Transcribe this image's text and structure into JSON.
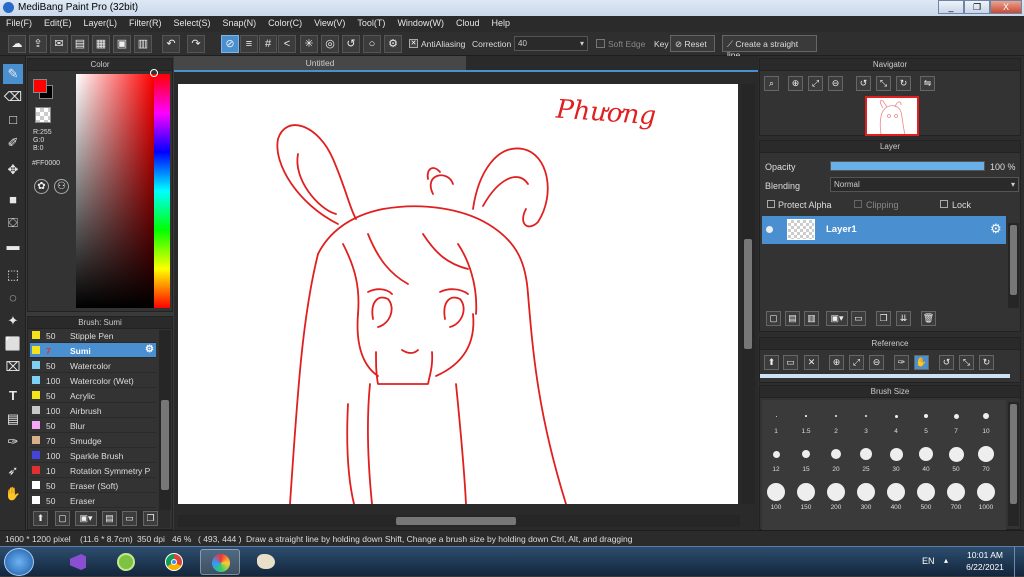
{
  "window": {
    "title": "MediBang Paint Pro (32bit)",
    "min": "_",
    "max": "❐",
    "close": "X"
  },
  "menu": [
    "File(F)",
    "Edit(E)",
    "Layer(L)",
    "Filter(R)",
    "Select(S)",
    "Snap(N)",
    "Color(C)",
    "View(V)",
    "Tool(T)",
    "Window(W)",
    "Cloud",
    "Help"
  ],
  "toolbar": {
    "antialiasing": "AntiAliasing",
    "correction_label": "Correction",
    "correction_value": "40",
    "soft_edge": "Soft Edge",
    "key": "Key",
    "reset": "Reset",
    "straight_line": "Create a straight line"
  },
  "color_panel": {
    "title": "Color",
    "r": "R:255",
    "g": "G:0",
    "b": "B:0",
    "hex": "#FF0000",
    "fg": "#ff0000",
    "bg": "#000000"
  },
  "brush_panel": {
    "title": "Brush: Sumi",
    "items": [
      {
        "size": "50",
        "name": "Stipple Pen",
        "color": "#f2e31b"
      },
      {
        "size": "7",
        "name": "Sumi",
        "color": "#f2e31b",
        "selected": true
      },
      {
        "size": "50",
        "name": "Watercolor",
        "color": "#7fd0f5"
      },
      {
        "size": "100",
        "name": "Watercolor (Wet)",
        "color": "#7fd0f5"
      },
      {
        "size": "50",
        "name": "Acrylic",
        "color": "#f2e31b"
      },
      {
        "size": "100",
        "name": "Airbrush",
        "color": "#c8c8c8"
      },
      {
        "size": "50",
        "name": "Blur",
        "color": "#f5a6f5"
      },
      {
        "size": "70",
        "name": "Smudge",
        "color": "#d8b08a"
      },
      {
        "size": "100",
        "name": "Sparkle Brush",
        "color": "#4444dd"
      },
      {
        "size": "10",
        "name": "Rotation Symmetry P",
        "color": "#e03030"
      },
      {
        "size": "50",
        "name": "Eraser (Soft)",
        "color": "#ffffff"
      },
      {
        "size": "50",
        "name": "Eraser",
        "color": "#ffffff"
      }
    ]
  },
  "document": {
    "tab": "Untitled",
    "signature": "Phương"
  },
  "navigator": {
    "title": "Navigator"
  },
  "layer_panel": {
    "title": "Layer",
    "opacity_label": "Opacity",
    "opacity_value": "100 %",
    "opacity": 1.0,
    "blending_label": "Blending",
    "blending_value": "Normal",
    "protect_alpha": "Protect Alpha",
    "clipping": "Clipping",
    "lock": "Lock",
    "layer_name": "Layer1"
  },
  "reference": {
    "title": "Reference"
  },
  "brush_size": {
    "title": "Brush Size",
    "sizes": [
      "1",
      "1.5",
      "2",
      "3",
      "4",
      "5",
      "7",
      "10",
      "12",
      "15",
      "20",
      "25",
      "30",
      "40",
      "50",
      "70",
      "100",
      "150",
      "200",
      "300",
      "400",
      "500",
      "700",
      "1000"
    ]
  },
  "status": {
    "dims": "1600 * 1200 pixel",
    "cm": "(11.6 * 8.7cm)",
    "dpi": "350 dpi",
    "zoom": "46 %",
    "coords": "( 493, 444 )",
    "hint": "Draw a straight line by holding down Shift, Change a brush size by holding down Ctrl, Alt, and dragging"
  },
  "taskbar": {
    "lang": "EN",
    "time": "10:01 AM",
    "date": "6/22/2021"
  }
}
